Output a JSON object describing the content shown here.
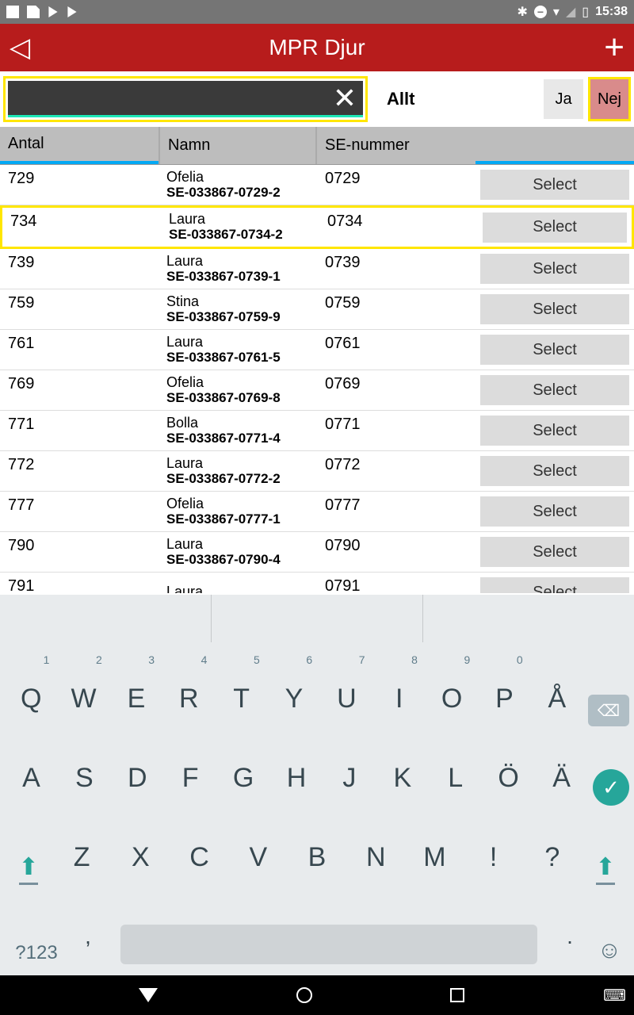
{
  "status": {
    "time": "15:38"
  },
  "appbar": {
    "title": "MPR Djur"
  },
  "search": {
    "value": ""
  },
  "filter": {
    "label": "Allt",
    "ja": "Ja",
    "nej": "Nej"
  },
  "columns": {
    "antal": "Antal",
    "namn": "Namn",
    "se": "SE-nummer"
  },
  "select_label": "Select",
  "rows": [
    {
      "antal": "729",
      "name": "Ofelia",
      "seid": "SE-033867-0729-2",
      "se": "0729",
      "hl": false
    },
    {
      "antal": "734",
      "name": "Laura",
      "seid": "SE-033867-0734-2",
      "se": "0734",
      "hl": true
    },
    {
      "antal": "739",
      "name": "Laura",
      "seid": "SE-033867-0739-1",
      "se": "0739",
      "hl": false
    },
    {
      "antal": "759",
      "name": "Stina",
      "seid": "SE-033867-0759-9",
      "se": "0759",
      "hl": false
    },
    {
      "antal": "761",
      "name": "Laura",
      "seid": "SE-033867-0761-5",
      "se": "0761",
      "hl": false
    },
    {
      "antal": "769",
      "name": "Ofelia",
      "seid": "SE-033867-0769-8",
      "se": "0769",
      "hl": false
    },
    {
      "antal": "771",
      "name": "Bolla",
      "seid": "SE-033867-0771-4",
      "se": "0771",
      "hl": false
    },
    {
      "antal": "772",
      "name": "Laura",
      "seid": "SE-033867-0772-2",
      "se": "0772",
      "hl": false
    },
    {
      "antal": "777",
      "name": "Ofelia",
      "seid": "SE-033867-0777-1",
      "se": "0777",
      "hl": false
    },
    {
      "antal": "790",
      "name": "Laura",
      "seid": "SE-033867-0790-4",
      "se": "0790",
      "hl": false
    },
    {
      "antal": "791",
      "name": "Laura",
      "seid": "",
      "se": "0791",
      "hl": false
    }
  ],
  "keyboard": {
    "row1": [
      {
        "k": "Q",
        "n": "1"
      },
      {
        "k": "W",
        "n": "2"
      },
      {
        "k": "E",
        "n": "3"
      },
      {
        "k": "R",
        "n": "4"
      },
      {
        "k": "T",
        "n": "5"
      },
      {
        "k": "Y",
        "n": "6"
      },
      {
        "k": "U",
        "n": "7"
      },
      {
        "k": "I",
        "n": "8"
      },
      {
        "k": "O",
        "n": "9"
      },
      {
        "k": "P",
        "n": "0"
      },
      {
        "k": "Å",
        "n": ""
      }
    ],
    "row2": [
      "A",
      "S",
      "D",
      "F",
      "G",
      "H",
      "J",
      "K",
      "L",
      "Ö",
      "Ä"
    ],
    "row3": [
      "Z",
      "X",
      "C",
      "V",
      "B",
      "N",
      "M",
      "!",
      "?"
    ],
    "sym": "?123",
    "comma": ",",
    "period": "."
  }
}
